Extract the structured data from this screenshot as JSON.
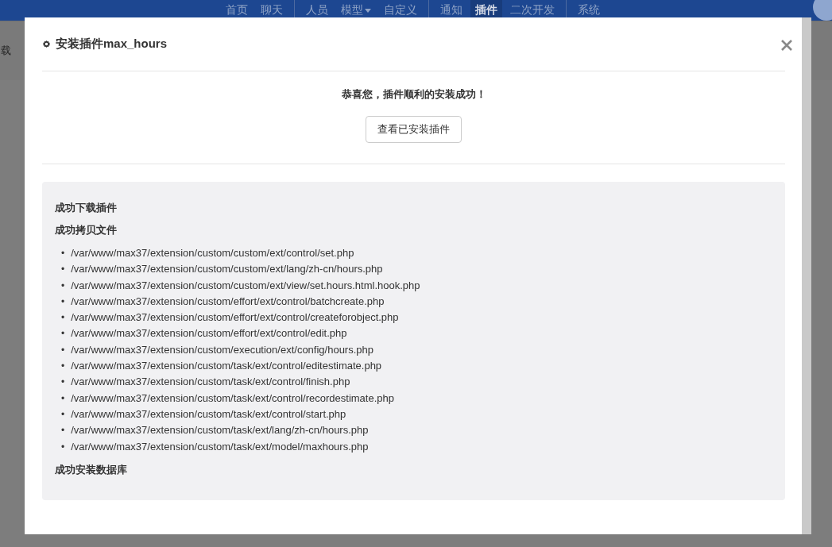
{
  "top_nav": {
    "groups": [
      [
        {
          "label": "首页",
          "selected": false,
          "dropdown": false
        },
        {
          "label": "聊天",
          "selected": false,
          "dropdown": false
        }
      ],
      [
        {
          "label": "人员",
          "selected": false,
          "dropdown": false
        },
        {
          "label": "模型",
          "selected": false,
          "dropdown": true
        },
        {
          "label": "自定义",
          "selected": false,
          "dropdown": false
        }
      ],
      [
        {
          "label": "通知",
          "selected": false,
          "dropdown": false
        },
        {
          "label": "插件",
          "selected": true,
          "dropdown": false
        },
        {
          "label": "二次开发",
          "selected": false,
          "dropdown": false
        }
      ],
      [
        {
          "label": "系统",
          "selected": false,
          "dropdown": false
        }
      ]
    ]
  },
  "page_fragment": "载",
  "dialog": {
    "title": "安装插件max_hours",
    "message": "恭喜您，插件顺利的安装成功！",
    "button": "查看已安装插件",
    "log": [
      {
        "kind": "heading",
        "text": "成功下载插件"
      },
      {
        "kind": "heading",
        "text": "成功拷贝文件"
      },
      {
        "kind": "files",
        "bullet": "•",
        "items": [
          "/var/www/max37/extension/custom/custom/ext/control/set.php",
          "/var/www/max37/extension/custom/custom/ext/lang/zh-cn/hours.php",
          "/var/www/max37/extension/custom/custom/ext/view/set.hours.html.hook.php",
          "/var/www/max37/extension/custom/effort/ext/control/batchcreate.php",
          "/var/www/max37/extension/custom/effort/ext/control/createforobject.php",
          "/var/www/max37/extension/custom/effort/ext/control/edit.php",
          "/var/www/max37/extension/custom/execution/ext/config/hours.php",
          "/var/www/max37/extension/custom/task/ext/control/editestimate.php",
          "/var/www/max37/extension/custom/task/ext/control/finish.php",
          "/var/www/max37/extension/custom/task/ext/control/recordestimate.php",
          "/var/www/max37/extension/custom/task/ext/control/start.php",
          "/var/www/max37/extension/custom/task/ext/lang/zh-cn/hours.php",
          "/var/www/max37/extension/custom/task/ext/model/maxhours.php"
        ]
      },
      {
        "kind": "heading",
        "text": "成功安装数据库"
      }
    ]
  }
}
